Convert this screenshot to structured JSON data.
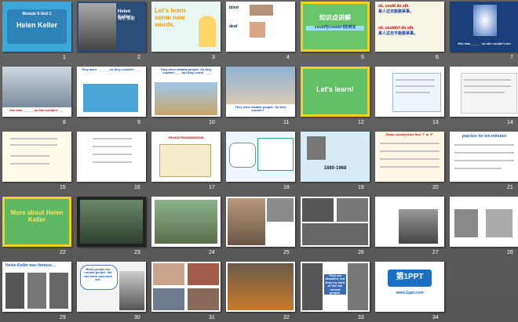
{
  "slide_numbers": [
    "1",
    "2",
    "3",
    "4",
    "5",
    "6",
    "7",
    "8",
    "9",
    "10",
    "11",
    "12",
    "13",
    "14",
    "15",
    "16",
    "17",
    "18",
    "19",
    "20",
    "21",
    "22",
    "23",
    "24",
    "25",
    "26",
    "27",
    "28",
    "29",
    "30",
    "31",
    "32",
    "33",
    "34"
  ],
  "s1": {
    "title": "Helen Keller",
    "module": "Module 9   Unit 1"
  },
  "s2": {
    "name": "Helen Keller",
    "sub": "海伦·凯勒"
  },
  "s3": {
    "title": "Let's learn some new words."
  },
  "s4": {
    "w1": "blind",
    "w2": "deaf"
  },
  "s5": {
    "title": "知识点讲解",
    "sub": "could与couldn't的用法"
  },
  "s6": {
    "l1": "sb. could do sth.",
    "l2": "某人过去能做某事。",
    "l3": "sb. couldn't do sth.",
    "l4": "某人过去不能做某事。"
  },
  "s7": {
    "cap": "She was______ so she couldn't see"
  },
  "s8": {
    "cap": "She was______, so she couldn't____"
  },
  "s9": {
    "cap": "They were ______, so they couldn't ____"
  },
  "s10": {
    "cap": "They were disable people. So they couldn't ___ but they could ___"
  },
  "s11": {
    "cap": "They were disable people. So they couldn't ___"
  },
  "s12": {
    "title": "Let's learn!"
  },
  "s17": {
    "title": "HEAD&TRANSMISSION"
  },
  "s19": {
    "year": "1880-1968"
  },
  "s20": {
    "title": "Read, silently then find 'T' or 'F'"
  },
  "s21": {
    "title": "practice for ten minutes"
  },
  "s22": {
    "title": "More about Helen Keller"
  },
  "s29": {
    "title": "Helen Keller was famous…"
  },
  "s30": {
    "quote": "Blind people are normal people. We can learn and work too."
  },
  "s33": {
    "cap": "They are disabled, but they try hard to live the normal people."
  },
  "s34": {
    "logo": "第1PPT",
    "sub": "www.1ppt.com"
  }
}
